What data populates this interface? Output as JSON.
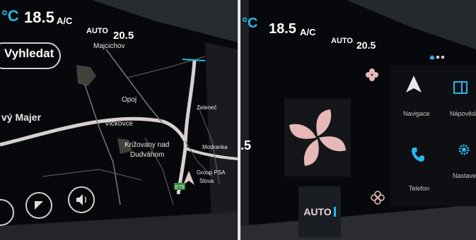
{
  "left_screen": {
    "temp_left": "18.5",
    "ac_label": "A/C",
    "auto_label": "AUTO",
    "temp_right": "20.5",
    "search_button": "Vyhledat",
    "map_labels": {
      "majcichov": "Majcichov",
      "opoj": "Opoj",
      "majer": "vý Majer",
      "vickovce": "Vlčkovce",
      "zelenec": "Zeleneč",
      "krizovany_1": "Križovany nad",
      "krizovany_2": "Dudváhom",
      "modranka": "Modranka",
      "groupe_1": "Group PSA",
      "groupe_2": "Slova",
      "road_e75": "E75"
    }
  },
  "right_screen": {
    "temp_left": "18.5",
    "ac_label": "A/C",
    "auto_label": "AUTO",
    "temp_right": "20.5",
    "side_temp": ".5",
    "auto_button": "AUTO",
    "apps": {
      "navigation": "Navigace",
      "help": "Nápověda",
      "phone": "Telefon",
      "settings": "Nastavení"
    },
    "colors": {
      "accent": "#27b7ea",
      "tile_bg": "#1a1d22",
      "fan": "#e6b8b8"
    }
  }
}
